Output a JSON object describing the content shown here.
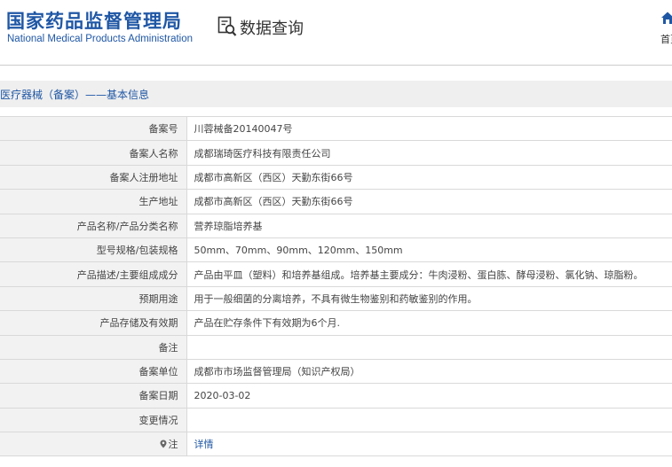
{
  "header": {
    "logo_cn": "国家药品监督管理局",
    "logo_en": "National Medical Products Administration",
    "query_title": "数据查询",
    "home_label": "首页"
  },
  "breadcrumb": {
    "text": "医疗器械（备案）——基本信息"
  },
  "rows": [
    {
      "label": "备案号",
      "value": "川蓉械备20140047号"
    },
    {
      "label": "备案人名称",
      "value": "成都瑞琦医疗科技有限责任公司"
    },
    {
      "label": "备案人注册地址",
      "value": "成都市高新区（西区）天勤东街66号"
    },
    {
      "label": "生产地址",
      "value": "成都市高新区（西区）天勤东街66号"
    },
    {
      "label": "产品名称/产品分类名称",
      "value": "营养琼脂培养基"
    },
    {
      "label": "型号规格/包装规格",
      "value": "50mm、70mm、90mm、120mm、150mm"
    },
    {
      "label": "产品描述/主要组成成分",
      "value": "产品由平皿（塑料）和培养基组成。培养基主要成分：牛肉浸粉、蛋白胨、酵母浸粉、氯化钠、琼脂粉。"
    },
    {
      "label": "预期用途",
      "value": "用于一般细菌的分离培养，不具有微生物鉴别和药敏鉴别的作用。"
    },
    {
      "label": "产品存储及有效期",
      "value": "产品在贮存条件下有效期为6个月."
    },
    {
      "label": "备注",
      "value": ""
    },
    {
      "label": "备案单位",
      "value": "成都市市场监督管理局（知识产权局）"
    },
    {
      "label": "备案日期",
      "value": "2020-03-02"
    },
    {
      "label": "变更情况",
      "value": ""
    }
  ],
  "footer": {
    "label": "注",
    "link": "详情"
  },
  "colors": {
    "brand_blue": "#1f57a5",
    "label_bg": "#f2f2f2",
    "crumb_bg": "#efefef"
  }
}
